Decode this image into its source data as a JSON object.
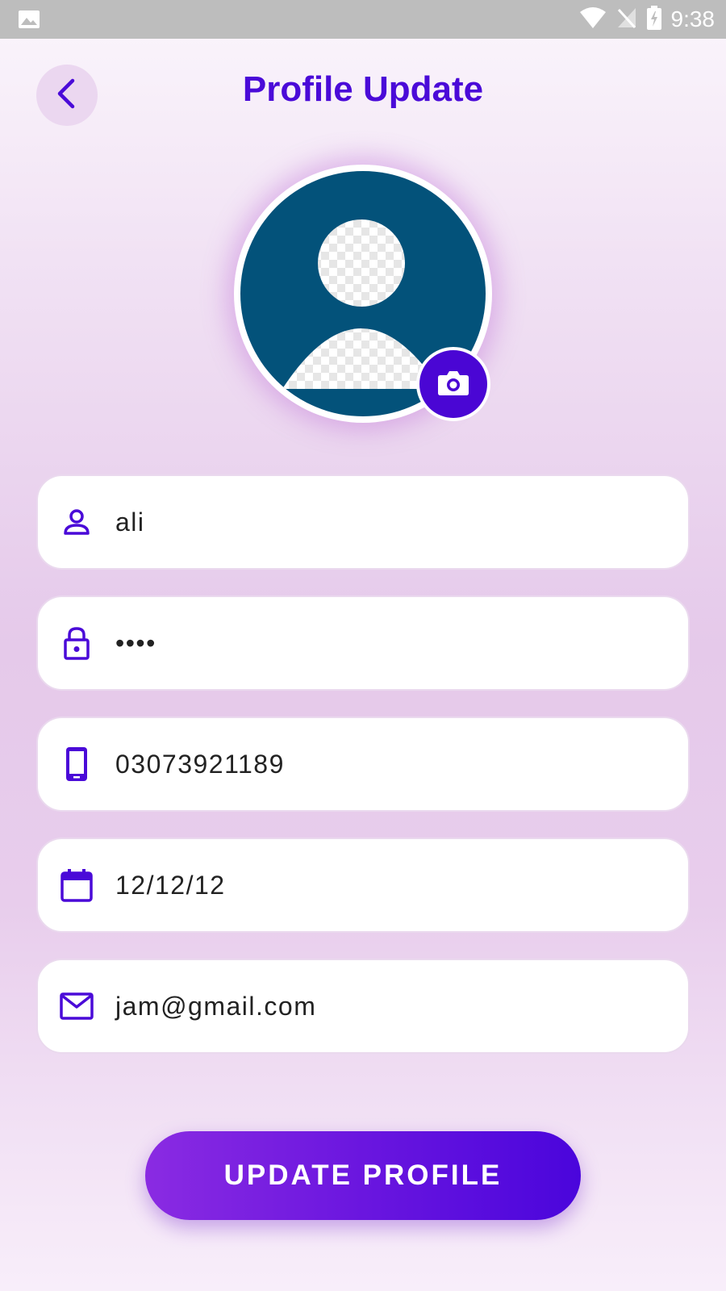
{
  "status_bar": {
    "time": "9:38",
    "icons": [
      "image-icon",
      "wifi-icon",
      "no-signal-icon",
      "battery-charging-icon"
    ]
  },
  "header": {
    "title": "Profile Update",
    "back_icon": "chevron-left-icon"
  },
  "avatar": {
    "camera_icon": "camera-icon",
    "ring_color": "#ffffff",
    "background_color": "#03527a"
  },
  "form": {
    "fields": [
      {
        "name": "username",
        "icon": "person-icon",
        "value": "ali"
      },
      {
        "name": "password",
        "icon": "lock-icon",
        "value": "••••"
      },
      {
        "name": "phone",
        "icon": "phone-icon",
        "value": "03073921189"
      },
      {
        "name": "date",
        "icon": "calendar-icon",
        "value": "12/12/12"
      },
      {
        "name": "email",
        "icon": "mail-icon",
        "value": "jam@gmail.com"
      }
    ]
  },
  "actions": {
    "update_label": "UPDATE PROFILE"
  },
  "colors": {
    "accent": "#4a0ad8",
    "button_start": "#8a2be2",
    "button_end": "#4a05dc"
  }
}
